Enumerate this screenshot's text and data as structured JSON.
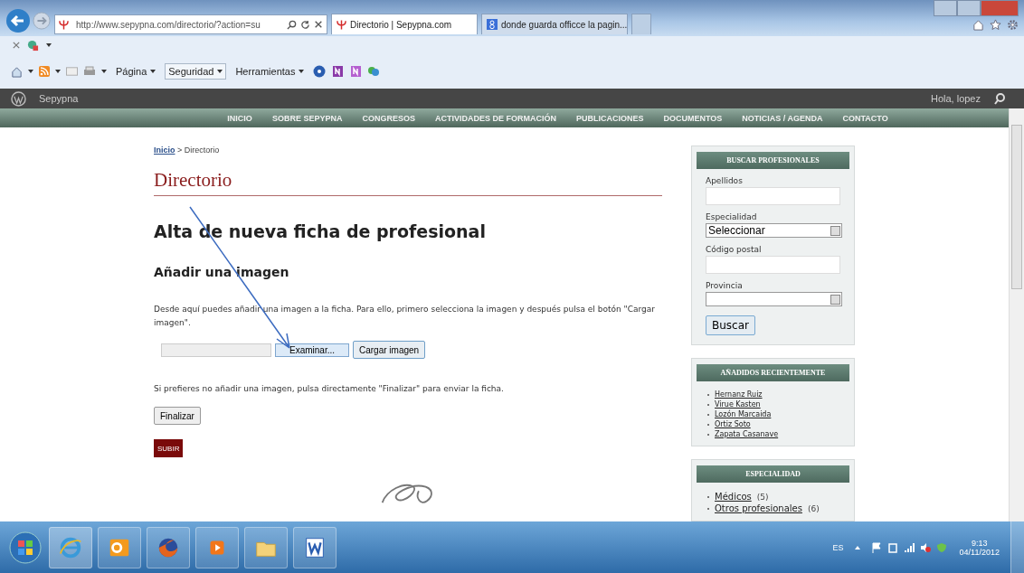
{
  "browser": {
    "address": "http://www.sepypna.com/directorio/?action=su",
    "tabs": [
      {
        "title": "Directorio | Sepypna.com",
        "selected": true
      },
      {
        "title": "donde guarda officce la pagin...",
        "selected": false
      }
    ],
    "commands": [
      "Página",
      "Seguridad",
      "Herramientas"
    ]
  },
  "admin_bar": {
    "site": "Sepypna",
    "greeting": "Hola, lopez"
  },
  "nav": [
    "INICIO",
    "SOBRE SEPYPNA",
    "CONGRESOS",
    "ACTIVIDADES DE FORMACIÓN",
    "PUBLICACIONES",
    "DOCUMENTOS",
    "NOTICIAS / AGENDA",
    "CONTACTO"
  ],
  "breadcrumb": {
    "link": "Inicio",
    "separator": ">",
    "current": "Directorio"
  },
  "page_title": "Directorio",
  "heading": "Alta de nueva ficha de profesional",
  "subheading": "Añadir una imagen",
  "intro": "Desde aquí puedes añadir una imagen a la ficha. Para ello, primero selecciona la imagen y después pulsa el botón \"Cargar imagen\".",
  "file_input": {
    "browse": "Examinar...",
    "upload": "Cargar imagen"
  },
  "note": "Si prefieres no añadir una imagen, pulsa directamente \"Finalizar\" para enviar la ficha.",
  "finish": "Finalizar",
  "top": "SUBIR",
  "sidebar": {
    "search": {
      "title": "BUSCAR PROFESIONALES",
      "fields": [
        {
          "kind": "text",
          "label": "Apellidos"
        },
        {
          "kind": "select",
          "label": "Especialidad",
          "value": "Seleccionar"
        },
        {
          "kind": "text",
          "label": "Código postal"
        },
        {
          "kind": "select",
          "label": "Provincia"
        }
      ],
      "button": "Buscar"
    },
    "recent": {
      "title": "AÑADIDOS RECIENTEMENTE",
      "items": [
        "Hernanz Ruiz",
        "Virue Kasten",
        "Lozón Marcaida",
        "Ortiz Soto",
        "Zapata Casanave"
      ]
    },
    "specialties": {
      "title": "ESPECIALIDAD",
      "items": [
        {
          "name": "Médicos",
          "count": "(5)"
        },
        {
          "name": "Otros profesionales",
          "count": "(6)"
        }
      ]
    }
  },
  "taskbar": {
    "language": "ES",
    "time": "9:13",
    "date": "04/11/2012"
  }
}
